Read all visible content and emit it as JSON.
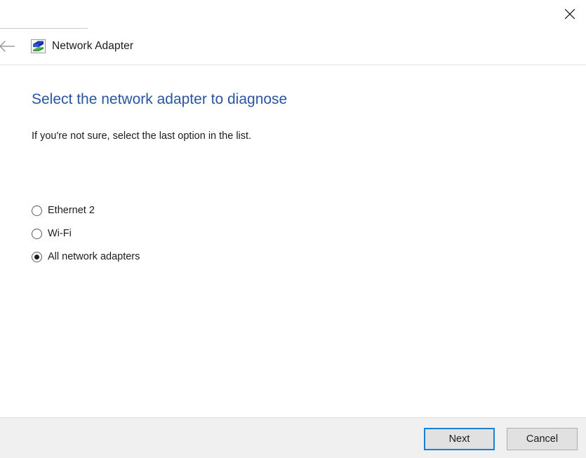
{
  "window": {
    "close_label": "×",
    "close_icon": "close-icon"
  },
  "header": {
    "back_icon": "back-arrow-icon",
    "app_icon": "network-adapter-icon",
    "title": "Network Adapter"
  },
  "main": {
    "heading": "Select the network adapter to diagnose",
    "subtext": "If you're not sure, select the last option in the list.",
    "options": [
      {
        "label": "Ethernet 2",
        "selected": false
      },
      {
        "label": "Wi-Fi",
        "selected": false
      },
      {
        "label": "All network adapters",
        "selected": true
      }
    ]
  },
  "footer": {
    "next_label": "Next",
    "cancel_label": "Cancel"
  },
  "colors": {
    "heading_blue": "#2a55a2",
    "focus_border": "#1683d8",
    "button_face": "#e1e1e1",
    "footer_bg": "#f0f0f0",
    "divider": "#e4e4e4"
  }
}
